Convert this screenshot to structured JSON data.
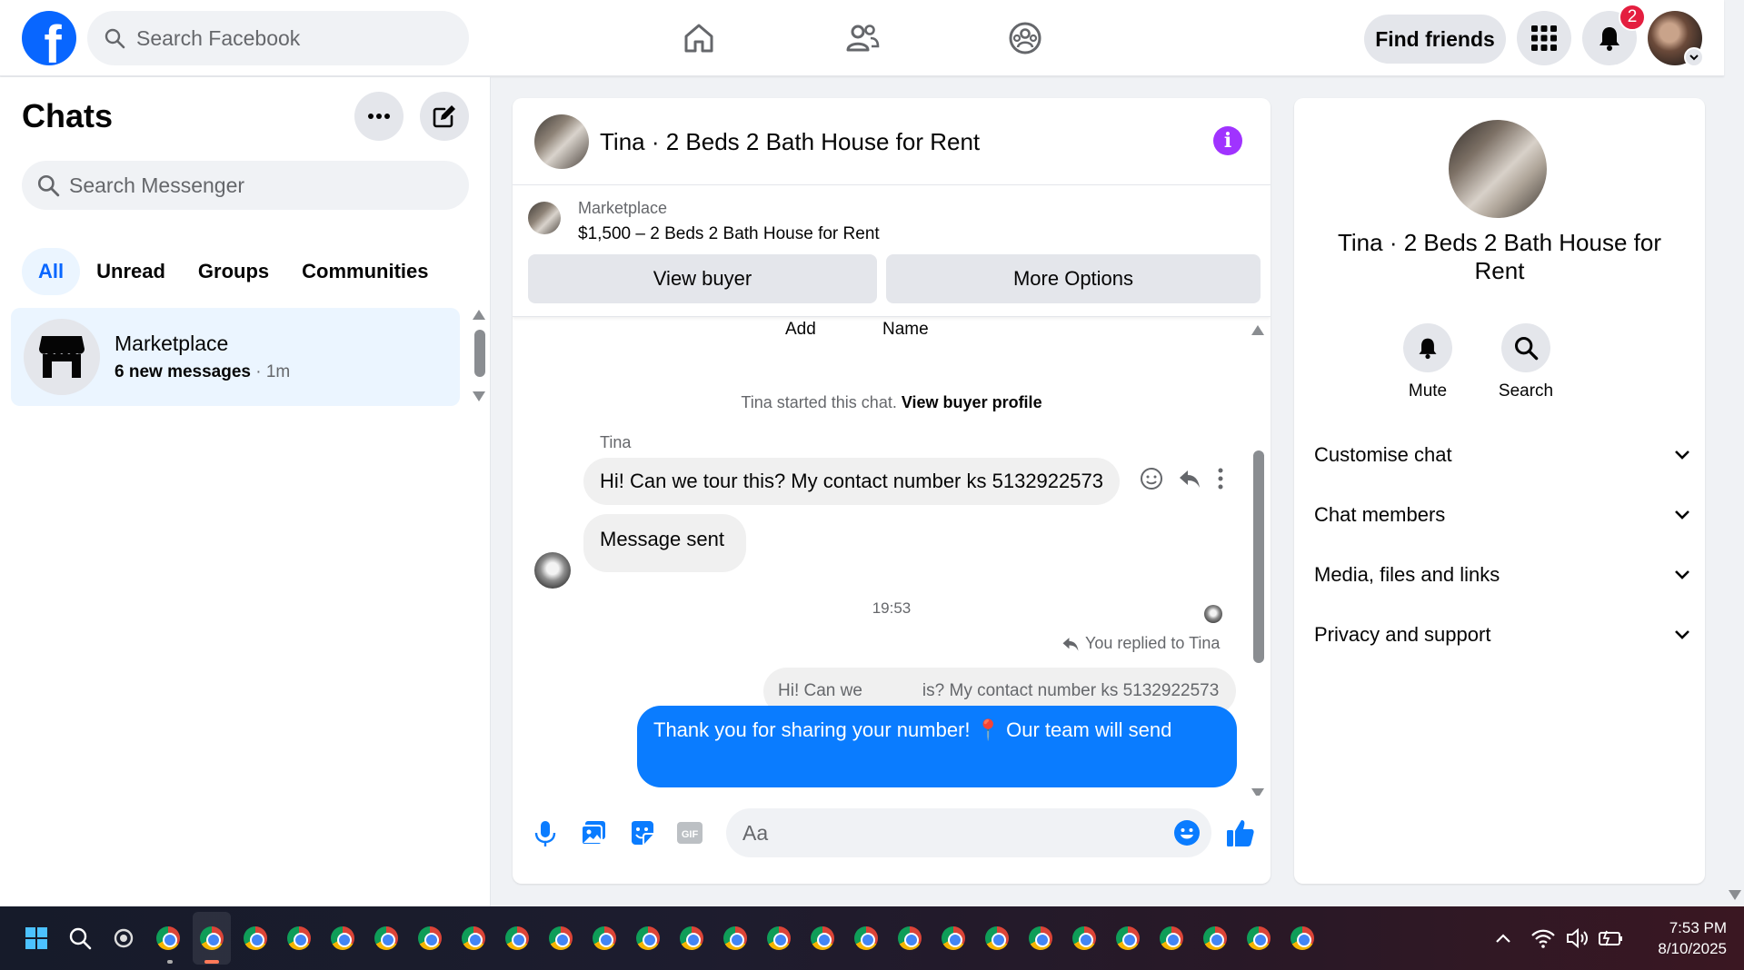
{
  "topbar": {
    "search_placeholder": "Search Facebook",
    "find_friends": "Find friends",
    "notification_count": "2"
  },
  "left": {
    "title": "Chats",
    "search_placeholder": "Search Messenger",
    "tabs": [
      "All",
      "Unread",
      "Groups",
      "Communities"
    ],
    "active_tab": "All",
    "chat": {
      "name": "Marketplace",
      "preview": "6 new messages",
      "time": " · 1m"
    }
  },
  "conversation": {
    "title": "Tina · 2 Beds 2 Bath House for Rent",
    "marketplace_label": "Marketplace",
    "listing": "$1,500 – 2 Beds 2 Bath House for Rent",
    "view_buyer": "View buyer",
    "more_options": "More Options",
    "cut_add": "Add",
    "cut_name": "Name",
    "started_text": "Tina started this chat.",
    "view_buyer_profile": "View buyer profile",
    "sender": "Tina",
    "message1": "Hi! Can we tour this? My contact number ks 5132922573",
    "message2": "Message sent",
    "timestamp": "19:53",
    "replied_to": "You replied to Tina",
    "quoted_left": "Hi! Can we",
    "quoted_right": "is? My contact number ks 5132922573",
    "outgoing": "Thank you for sharing your number! 📍 Our team will send",
    "composer_placeholder": "Aa"
  },
  "info": {
    "name": "Tina · 2 Beds 2 Bath House for Rent",
    "mute": "Mute",
    "search": "Search",
    "sections": [
      "Customise chat",
      "Chat members",
      "Media, files and links",
      "Privacy and support"
    ]
  },
  "taskbar": {
    "time": "7:53 PM",
    "date": "8/10/2025"
  },
  "colors": {
    "brand_blue": "#0866ff",
    "messenger_blue": "#0a7cff",
    "info_purple": "#a033ff",
    "badge_red": "#e41e3f"
  }
}
